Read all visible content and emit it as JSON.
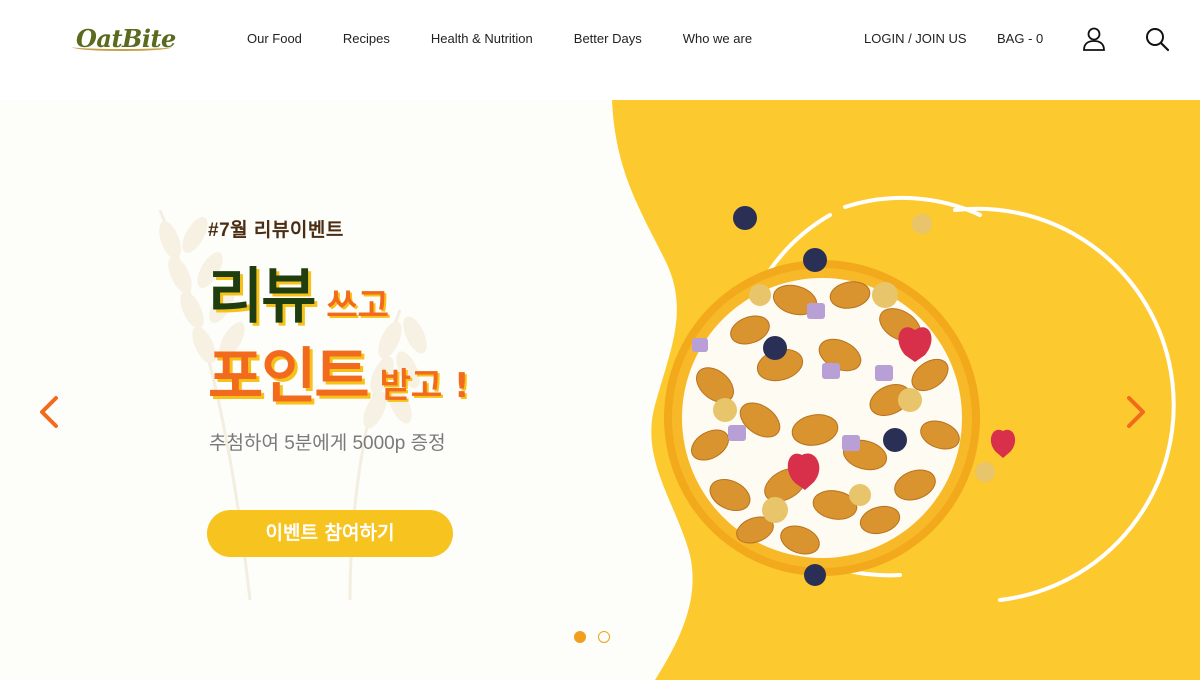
{
  "brand": {
    "logo_text": "OatBite"
  },
  "nav": {
    "items": [
      {
        "label": "Our Food"
      },
      {
        "label": "Recipes"
      },
      {
        "label": "Health & Nutrition"
      },
      {
        "label": "Better Days"
      },
      {
        "label": "Who we are"
      }
    ]
  },
  "header_utils": {
    "login_label": "LOGIN / JOIN US",
    "bag_label": "BAG - 0",
    "user_icon": "user-icon",
    "search_icon": "search-icon"
  },
  "hero": {
    "event_tag": "#7월 리뷰이벤트",
    "headline_line1_big": "리뷰",
    "headline_line1_small": "쓰고",
    "headline_line2_big": "포인트",
    "headline_line2_small": "받고 !",
    "sub_copy": "추첨하여 5분에게 5000p 증정",
    "cta_label": "이벤트 참여하기",
    "prev_icon": "chevron-left-icon",
    "next_icon": "chevron-right-icon",
    "slides_total": 2,
    "active_slide": 1
  },
  "colors": {
    "accent_yellow": "#f7c31e",
    "accent_orange": "#f26a1b",
    "dark_green": "#1f3d0f",
    "brown_tag": "#4a2d12",
    "dot_color": "#f0a01c"
  }
}
